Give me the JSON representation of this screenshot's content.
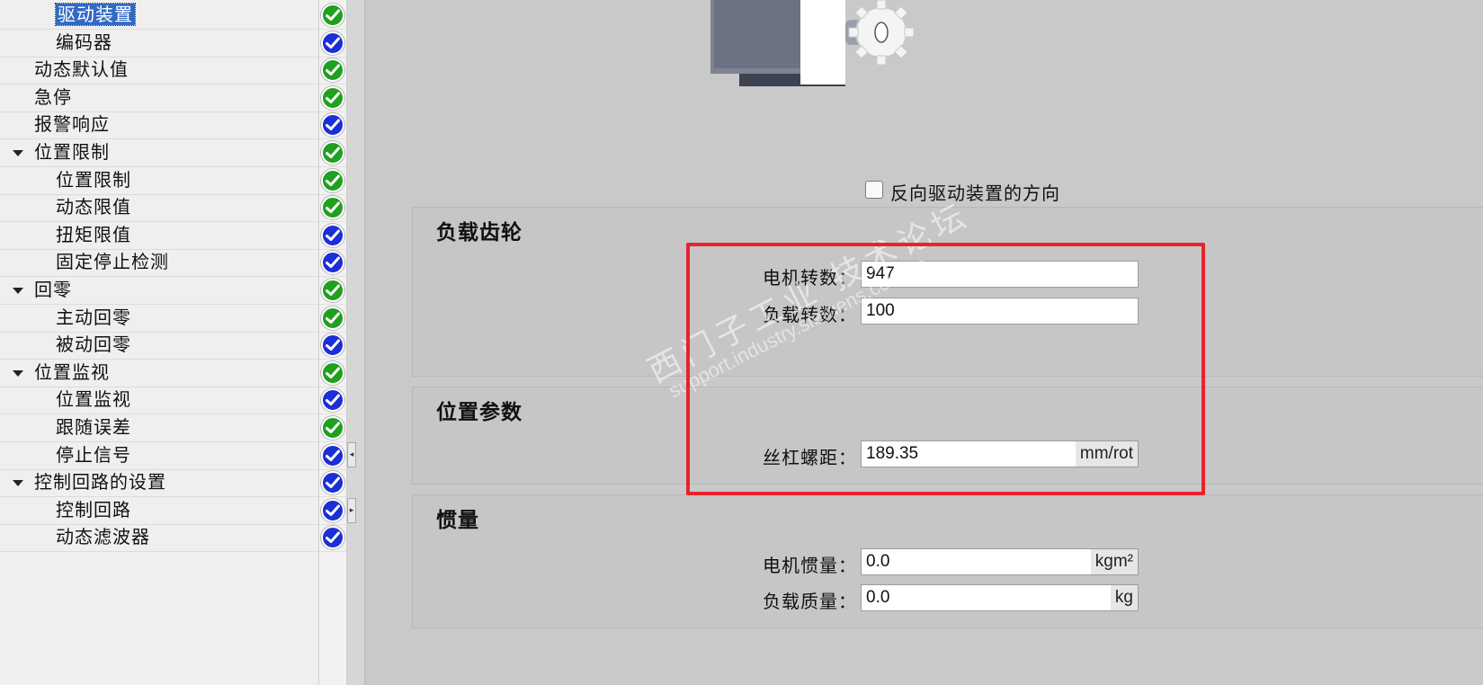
{
  "nav": {
    "items": [
      {
        "label": "驱动装置",
        "level": 2,
        "expanded": null,
        "selected": true,
        "status": "green"
      },
      {
        "label": "编码器",
        "level": 2,
        "expanded": null,
        "selected": false,
        "status": "blue"
      },
      {
        "label": "动态默认值",
        "level": 1,
        "expanded": null,
        "selected": false,
        "status": "green"
      },
      {
        "label": "急停",
        "level": 1,
        "expanded": null,
        "selected": false,
        "status": "green"
      },
      {
        "label": "报警响应",
        "level": 1,
        "expanded": null,
        "selected": false,
        "status": "blue"
      },
      {
        "label": "位置限制",
        "level": 1,
        "expanded": true,
        "selected": false,
        "status": "green"
      },
      {
        "label": "位置限制",
        "level": 2,
        "expanded": null,
        "selected": false,
        "status": "green"
      },
      {
        "label": "动态限值",
        "level": 2,
        "expanded": null,
        "selected": false,
        "status": "green"
      },
      {
        "label": "扭矩限值",
        "level": 2,
        "expanded": null,
        "selected": false,
        "status": "blue"
      },
      {
        "label": "固定停止检测",
        "level": 2,
        "expanded": null,
        "selected": false,
        "status": "blue"
      },
      {
        "label": "回零",
        "level": 1,
        "expanded": true,
        "selected": false,
        "status": "green"
      },
      {
        "label": "主动回零",
        "level": 2,
        "expanded": null,
        "selected": false,
        "status": "green"
      },
      {
        "label": "被动回零",
        "level": 2,
        "expanded": null,
        "selected": false,
        "status": "blue"
      },
      {
        "label": "位置监视",
        "level": 1,
        "expanded": true,
        "selected": false,
        "status": "green"
      },
      {
        "label": "位置监视",
        "level": 2,
        "expanded": null,
        "selected": false,
        "status": "blue"
      },
      {
        "label": "跟随误差",
        "level": 2,
        "expanded": null,
        "selected": false,
        "status": "green"
      },
      {
        "label": "停止信号",
        "level": 2,
        "expanded": null,
        "selected": false,
        "status": "blue"
      },
      {
        "label": "控制回路的设置",
        "level": 1,
        "expanded": true,
        "selected": false,
        "status": "blue"
      },
      {
        "label": "控制回路",
        "level": 2,
        "expanded": null,
        "selected": false,
        "status": "blue"
      },
      {
        "label": "动态滤波器",
        "level": 2,
        "expanded": null,
        "selected": false,
        "status": "blue"
      }
    ]
  },
  "colors": {
    "status_green": "#1fa01f",
    "status_blue": "#1a2fd6",
    "highlight_red": "#e8232d"
  },
  "drive": {
    "invert_direction_label": "反向驱动装置的方向",
    "invert_direction_checked": false
  },
  "load_gear": {
    "title": "负载齿轮",
    "motor_revs_label": "电机转数：",
    "motor_revs_value": "947",
    "load_revs_label": "负载转数：",
    "load_revs_value": "100"
  },
  "position_params": {
    "title": "位置参数",
    "leadscrew_pitch_label": "丝杠螺距：",
    "leadscrew_pitch_value": "189.35",
    "leadscrew_pitch_unit": "mm/rot"
  },
  "inertia": {
    "title": "惯量",
    "motor_inertia_label": "电机惯量：",
    "motor_inertia_value": "0.0",
    "motor_inertia_unit": "kgm²",
    "load_mass_label": "负载质量：",
    "load_mass_value": "0.0",
    "load_mass_unit": "kg"
  },
  "watermark": {
    "text_cn": "西门子工业 技术论坛",
    "text_url": "support.industry.siemens.com/cs"
  }
}
